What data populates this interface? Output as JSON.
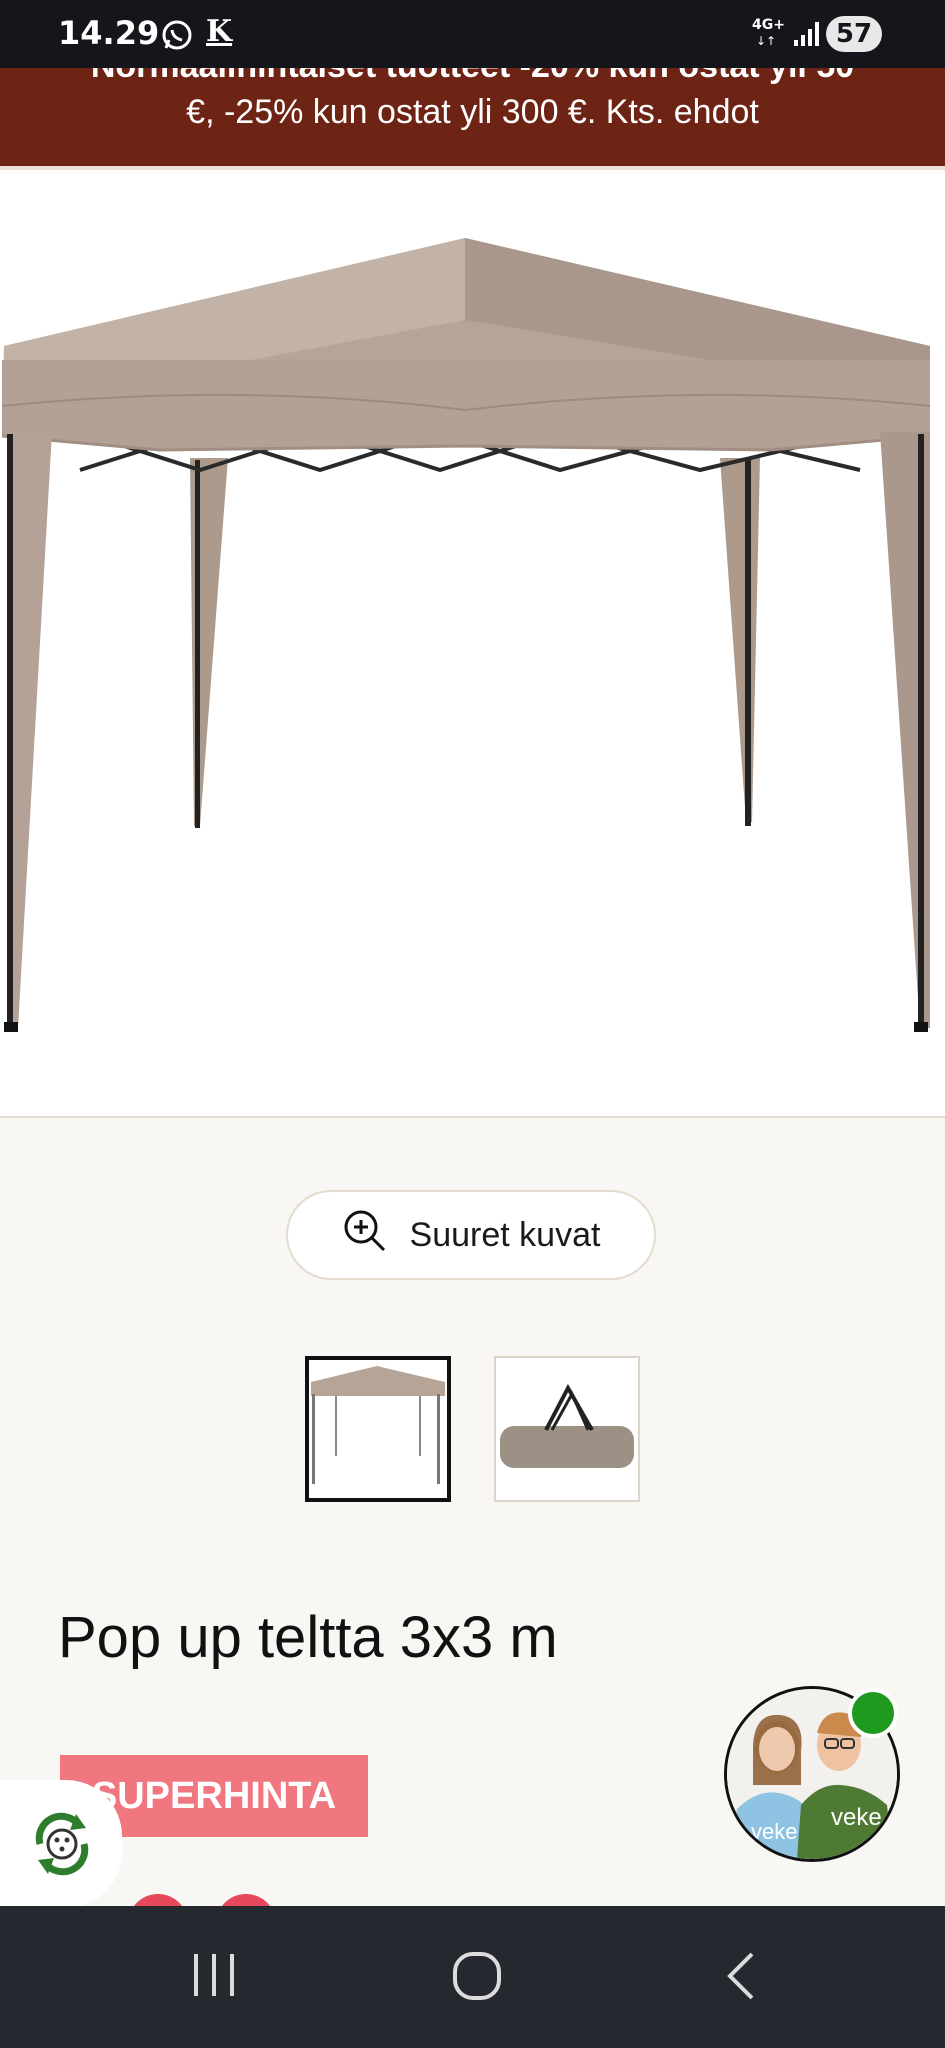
{
  "status_bar": {
    "time": "14.29",
    "carrier_badge": "K",
    "network": "4G+",
    "network_arrows": "↓↑",
    "battery": "57"
  },
  "promo": {
    "line1": "Normaalihintaiset tuotteet -20% kun ostat yli 50",
    "line2": "€, -25% kun ostat yli 300 €. Kts. ehdot"
  },
  "gallery": {
    "zoom_label": "Suuret kuvat"
  },
  "product": {
    "title": "Pop up teltta 3x3 m",
    "badge": "SUPERHINTA"
  },
  "chat": {
    "shirt_text": "veke",
    "shirt_text_2": "veke"
  },
  "colors": {
    "promo_bg": "#6e2415",
    "badge_bg": "#f0767f",
    "online": "#1f9a1f",
    "canopy": "#b6a597"
  },
  "icons": [
    "whatsapp-icon",
    "signal-icon",
    "zoom-in-icon",
    "recycle-icon",
    "recents-icon",
    "home-icon",
    "back-icon"
  ]
}
